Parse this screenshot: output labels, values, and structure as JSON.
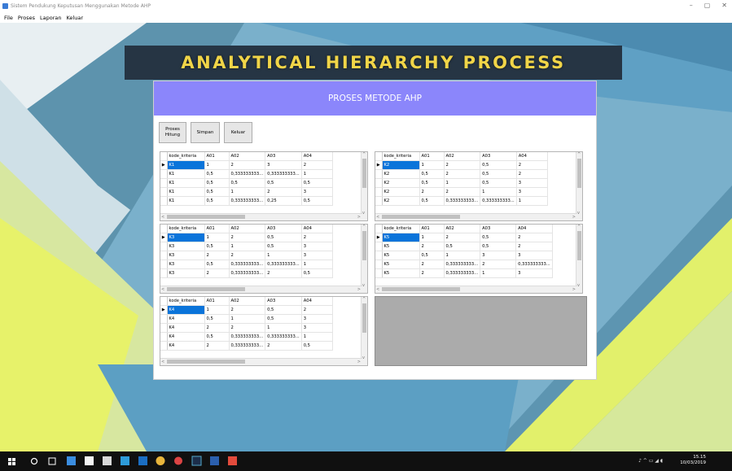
{
  "window": {
    "title": "Sistem Pendukung Keputusan Menggunakan Metode AHP",
    "controls": [
      "–",
      "▢",
      "✕"
    ]
  },
  "menu": [
    "File",
    "Proses",
    "Laporan",
    "Keluar"
  ],
  "banner": "ANALYTICAL HIERARCHY PROCESS",
  "form": {
    "header": "PROSES METODE AHP",
    "buttons": {
      "proses": "Proses\nHitung",
      "simpan": "Simpan",
      "keluar": "Keluar"
    }
  },
  "grid_columns": [
    "kode_kriteria",
    "A01",
    "A02",
    "A03",
    "A04"
  ],
  "grids": [
    {
      "id": "k1",
      "rows": [
        [
          "K1",
          "1",
          "2",
          "3",
          "2"
        ],
        [
          "K1",
          "0,5",
          "0,333333333...",
          "0,333333333...",
          "1"
        ],
        [
          "K1",
          "0,5",
          "0,5",
          "0,5",
          "0,5"
        ],
        [
          "K1",
          "0,5",
          "1",
          "2",
          "3"
        ],
        [
          "K1",
          "0,5",
          "0,333333333...",
          "0,25",
          "0,5"
        ]
      ]
    },
    {
      "id": "k2",
      "rows": [
        [
          "K2",
          "1",
          "2",
          "0,5",
          "2"
        ],
        [
          "K2",
          "0,5",
          "2",
          "0,5",
          "2"
        ],
        [
          "K2",
          "0,5",
          "1",
          "0,5",
          "3"
        ],
        [
          "K2",
          "2",
          "2",
          "1",
          "3"
        ],
        [
          "K2",
          "0,5",
          "0,333333333...",
          "0,333333333...",
          "1"
        ]
      ]
    },
    {
      "id": "k3",
      "rows": [
        [
          "K3",
          "1",
          "2",
          "0,5",
          "2"
        ],
        [
          "K3",
          "0,5",
          "1",
          "0,5",
          "3"
        ],
        [
          "K3",
          "2",
          "2",
          "1",
          "3"
        ],
        [
          "K3",
          "0,5",
          "0,333333333...",
          "0,333333333...",
          "1"
        ],
        [
          "K3",
          "2",
          "0,333333333...",
          "2",
          "0,5"
        ]
      ]
    },
    {
      "id": "k5",
      "rows": [
        [
          "K5",
          "1",
          "2",
          "0,5",
          "2"
        ],
        [
          "K5",
          "2",
          "0,5",
          "0,5",
          "2"
        ],
        [
          "K5",
          "0,5",
          "1",
          "3",
          "3"
        ],
        [
          "K5",
          "2",
          "0,333333333...",
          "2",
          "0,333333333..."
        ],
        [
          "K5",
          "2",
          "0,333333333...",
          "1",
          "3"
        ]
      ]
    },
    {
      "id": "k4",
      "rows": [
        [
          "K4",
          "1",
          "2",
          "0,5",
          "2"
        ],
        [
          "K4",
          "0,5",
          "1",
          "0,5",
          "3"
        ],
        [
          "K4",
          "2",
          "2",
          "1",
          "3"
        ],
        [
          "K4",
          "0,5",
          "0,333333333...",
          "0,333333333...",
          "1"
        ],
        [
          "K4",
          "2",
          "0,333333333...",
          "2",
          "0,5"
        ]
      ]
    }
  ],
  "taskbar": {
    "time": "15.15",
    "date": "10/03/2019"
  },
  "colors": {
    "header": "#8b86fb",
    "banner_bg": "#263544",
    "banner_text": "#f1d548",
    "selection": "#0a74da"
  }
}
